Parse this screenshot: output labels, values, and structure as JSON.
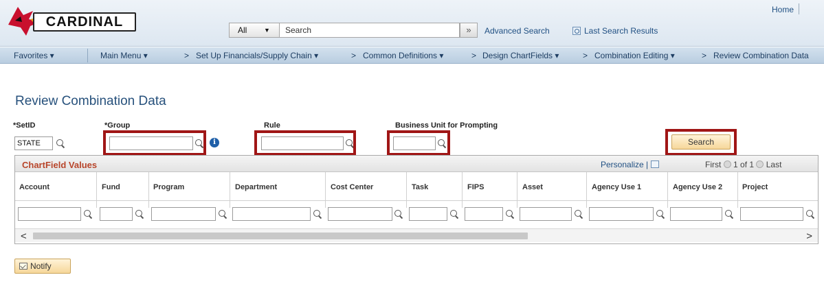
{
  "header": {
    "logo_text": "CARDINAL",
    "home_link": "Home",
    "search": {
      "scope": "All",
      "placeholder": "Search",
      "go_symbol": "»",
      "advanced_search": "Advanced Search",
      "last_results": "Last Search Results"
    }
  },
  "nav": {
    "items": [
      {
        "label": "Favorites ▾"
      },
      {
        "label": "Main Menu ▾"
      },
      {
        "label": ">"
      },
      {
        "label": "Set Up Financials/Supply Chain ▾"
      },
      {
        "label": ">"
      },
      {
        "label": "Common Definitions ▾"
      },
      {
        "label": ">"
      },
      {
        "label": "Design ChartFields ▾"
      },
      {
        "label": ">"
      },
      {
        "label": "Combination Editing ▾"
      },
      {
        "label": ">"
      },
      {
        "label": "Review Combination Data"
      }
    ]
  },
  "page": {
    "title": "Review Combination Data"
  },
  "criteria": {
    "setid_label": "*SetID",
    "setid_value": "STATE",
    "group_label": "*Group",
    "group_value": "",
    "rule_label": "Rule",
    "rule_value": "",
    "bu_label": "Business Unit for Prompting",
    "bu_value": "",
    "search_button": "Search"
  },
  "grid": {
    "title": "ChartField Values",
    "personalize": "Personalize",
    "pipe": "|",
    "first": "First",
    "page_info": "1 of 1",
    "last": "Last",
    "columns": [
      "Account",
      "Fund",
      "Program",
      "Department",
      "Cost Center",
      "Task",
      "FIPS",
      "Asset",
      "Agency Use 1",
      "Agency Use 2",
      "Project"
    ],
    "scroll_left": "<",
    "scroll_right": ">"
  },
  "footer": {
    "notify_button": "Notify"
  },
  "colors": {
    "highlight": "#a01616",
    "title_blue": "#27517c",
    "grid_title": "#b8452a",
    "button_gold": "#f6d79a"
  }
}
